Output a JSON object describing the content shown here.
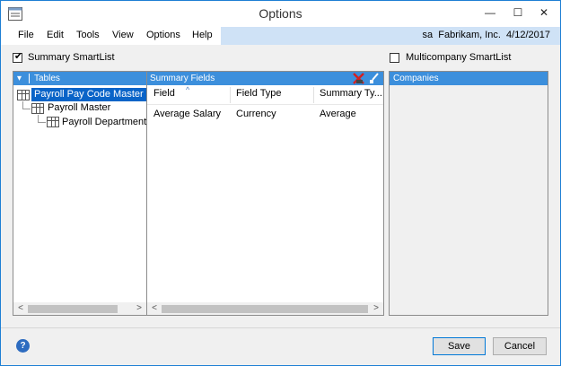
{
  "window": {
    "title": "Options"
  },
  "title_buttons": {
    "minimize": "—",
    "maximize": "☐",
    "close": "✕"
  },
  "menu": {
    "items": [
      "File",
      "Edit",
      "Tools",
      "View",
      "Options",
      "Help"
    ],
    "user_info": "sa  Fabrikam, Inc.  4/12/2017"
  },
  "summary_smartlist": {
    "label": "Summary SmartList",
    "checked": true
  },
  "multicompany_smartlist": {
    "label": "Multicompany SmartList",
    "checked": false
  },
  "tables": {
    "header": "Tables",
    "nodes": [
      "Payroll Pay Code Master",
      "Payroll Master",
      "Payroll Department S"
    ]
  },
  "summary_fields": {
    "header": "Summary Fields",
    "columns": [
      "Field",
      "Field Type",
      "Summary Ty..."
    ],
    "rows": [
      [
        "Average Salary",
        "Currency",
        "Average"
      ]
    ]
  },
  "companies": {
    "header": "Companies"
  },
  "buttons": {
    "save": "Save",
    "cancel": "Cancel"
  },
  "icons": {
    "help": "?",
    "scroll_left": "<",
    "scroll_right": ">",
    "sort_asc": "^",
    "dropdown": "▾"
  }
}
